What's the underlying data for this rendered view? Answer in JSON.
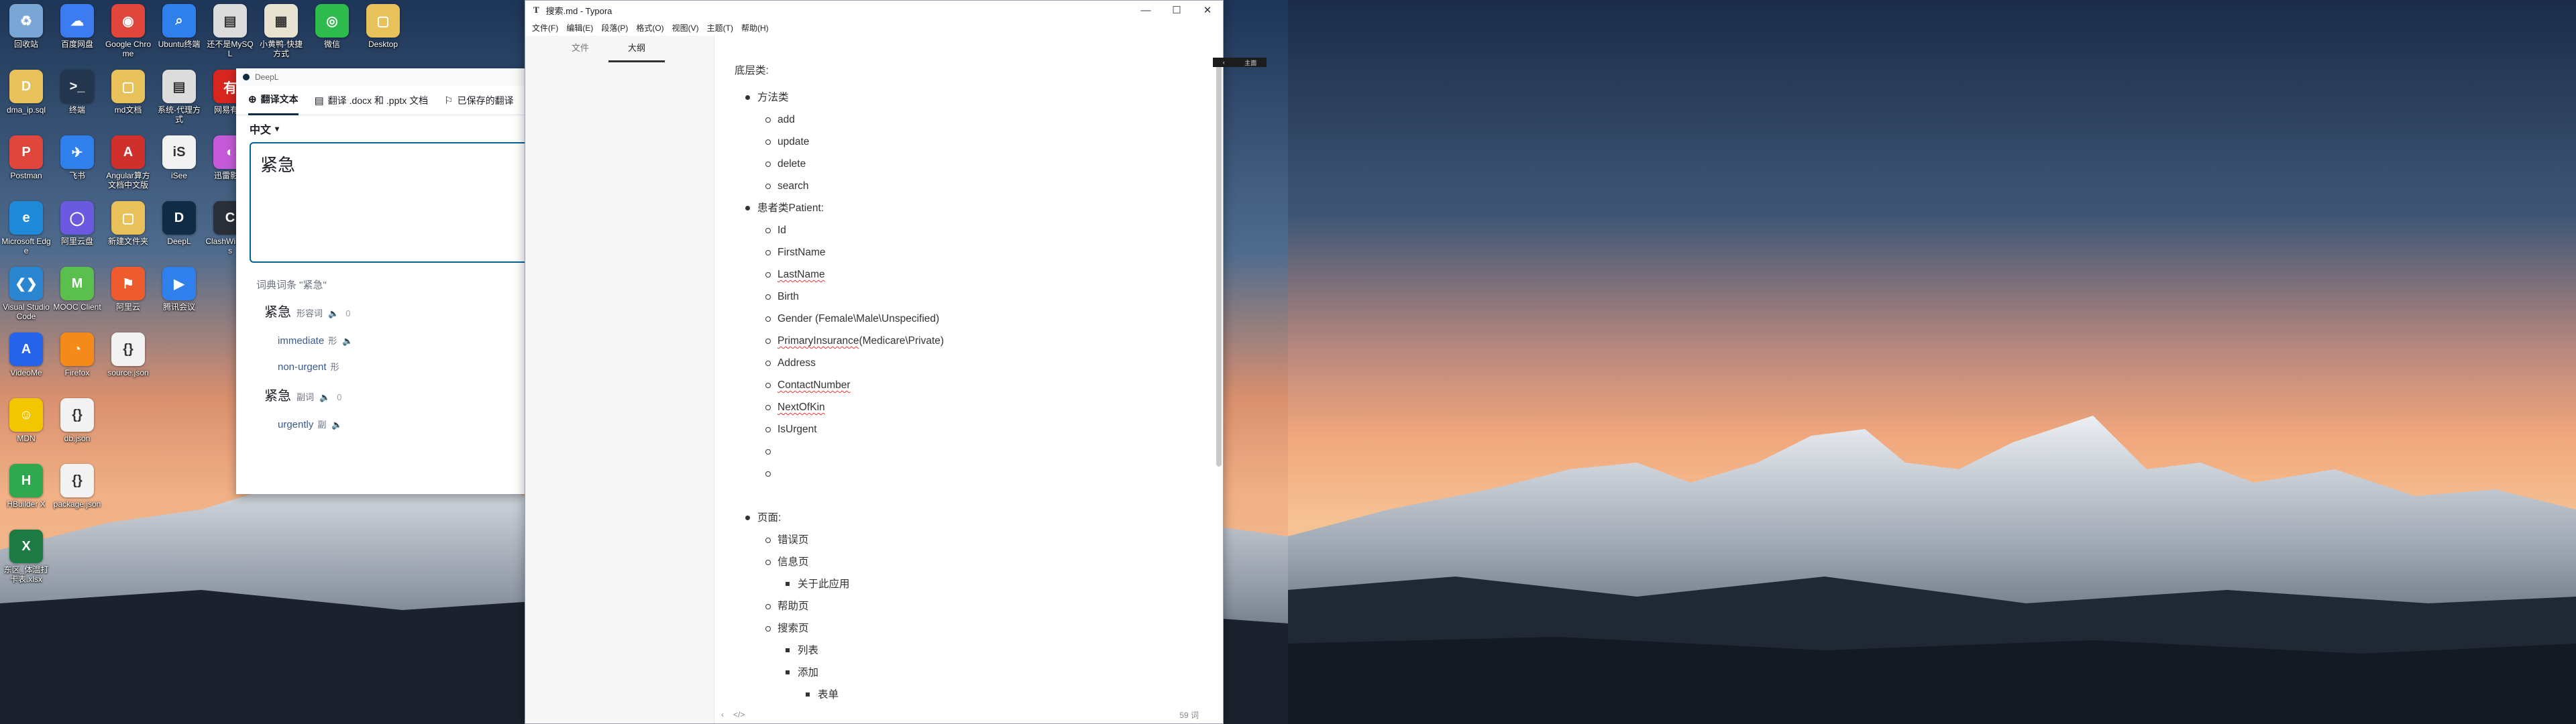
{
  "desktop": {
    "icons": [
      {
        "label": "回收站",
        "glyph": "♻",
        "color": "#7aa6d6"
      },
      {
        "label": "百度网盘",
        "glyph": "☁",
        "color": "#3d7bf0"
      },
      {
        "label": "Google Chrome",
        "glyph": "◉",
        "color": "#e0463b"
      },
      {
        "label": "Ubuntu终端",
        "glyph": "⌕",
        "color": "#2f80ed"
      },
      {
        "label": "还不是MySQL",
        "glyph": "▤",
        "color": "#dcdcdc"
      },
      {
        "label": "小黄鸭·快捷方式",
        "glyph": "▦",
        "color": "#e8e2d0"
      },
      {
        "label": "微信",
        "glyph": "◎",
        "color": "#2dbb4e"
      },
      {
        "label": "Desktop",
        "glyph": "▢",
        "color": "#e8c15a"
      },
      {
        "label": "dma_ip.sql",
        "glyph": "D",
        "color": "#e8c15a"
      },
      {
        "label": "终端",
        "glyph": ">_",
        "color": "#23364d"
      },
      {
        "label": "md文档",
        "glyph": "▢",
        "color": "#e8c15a"
      },
      {
        "label": "系统-代理方式",
        "glyph": "▤",
        "color": "#dcdcdc"
      },
      {
        "label": "网易有道",
        "glyph": "有",
        "color": "#d7261e"
      },
      {
        "label": "Postman",
        "glyph": "P",
        "color": "#e0463b"
      },
      {
        "label": "飞书",
        "glyph": "✈",
        "color": "#2f80ed"
      },
      {
        "label": "Angular算方文档中文版",
        "glyph": "A",
        "color": "#d0302c"
      },
      {
        "label": "iSee",
        "glyph": "iS",
        "color": "#f2f2f2"
      },
      {
        "label": "迅雷影音",
        "glyph": "◐",
        "color": "#c45ad8"
      },
      {
        "label": "Microsoft Edge",
        "glyph": "e",
        "color": "#1f8ad8"
      },
      {
        "label": "阿里云盘",
        "glyph": "◯",
        "color": "#6a5ae0"
      },
      {
        "label": "新建文件夹",
        "glyph": "▢",
        "color": "#e8c15a"
      },
      {
        "label": "DeepL",
        "glyph": "D",
        "color": "#0f2b46"
      },
      {
        "label": "ClashWindows",
        "glyph": "C",
        "color": "#2b2f3a"
      },
      {
        "label": "Visual Studio Code",
        "glyph": "❮❯",
        "color": "#2a86d1"
      },
      {
        "label": "MOOC Client",
        "glyph": "M",
        "color": "#5bbf4e"
      },
      {
        "label": "阿里云",
        "glyph": "⚑",
        "color": "#ee5b2e"
      },
      {
        "label": "腾讯会议",
        "glyph": "▶",
        "color": "#2f80ed"
      },
      {
        "label": "VideoMe",
        "glyph": "A",
        "color": "#2563eb"
      },
      {
        "label": "Firefox",
        "glyph": "◔",
        "color": "#f48a1a"
      },
      {
        "label": "source.json",
        "glyph": "{}",
        "color": "#f2f2f2"
      },
      {
        "label": "MDN",
        "glyph": "☺",
        "color": "#f2c600"
      },
      {
        "label": "db.json",
        "glyph": "{}",
        "color": "#f2f2f2"
      },
      {
        "label": "HBuilder X",
        "glyph": "H",
        "color": "#2fa84f"
      },
      {
        "label": "package.json",
        "glyph": "{}",
        "color": "#f2f2f2"
      },
      {
        "label": "东区_体温打卡表.xlsx",
        "glyph": "X",
        "color": "#1d7a44"
      }
    ]
  },
  "deepl": {
    "window_title": "DeepL",
    "tabs": [
      {
        "label": "翻译文本",
        "icon": "globe-icon"
      },
      {
        "label": "翻译 .docx 和 .pptx 文档",
        "icon": "document-icon"
      },
      {
        "label": "已保存的翻译",
        "icon": "bookmark-icon"
      }
    ],
    "source_lang": "中文",
    "input_text": "紧急",
    "dictionary_header": "词典词条 \"紧急\"",
    "entries": [
      {
        "word": "紧急",
        "pos": "形容词",
        "count": "0",
        "translations": [
          {
            "text": "immediate",
            "pos": "形"
          },
          {
            "text": "non-urgent",
            "pos": "形"
          }
        ]
      },
      {
        "word": "紧急",
        "pos": "副词",
        "count": "0",
        "translations": [
          {
            "text": "urgently",
            "pos": "副"
          }
        ]
      }
    ]
  },
  "typora": {
    "window_title": "搜索.md - Typora",
    "menus": [
      "文件(F)",
      "编辑(E)",
      "段落(P)",
      "格式(O)",
      "视图(V)",
      "主题(T)",
      "帮助(H)"
    ],
    "sidebar_tabs": [
      "文件",
      "大纲"
    ],
    "active_sidebar_tab": "大纲",
    "doc": {
      "heading": "底层类:",
      "section1": {
        "label": "方法类",
        "items": [
          "add",
          "update",
          "delete",
          "search"
        ]
      },
      "section2": {
        "label": "患者类Patient:",
        "items": [
          {
            "text": "Id",
            "spell": false
          },
          {
            "text": "FirstName",
            "spell": false
          },
          {
            "text": "LastName",
            "spell": true
          },
          {
            "text": "Birth",
            "spell": false
          },
          {
            "text": "Gender (Female\\Male\\Unspecified)",
            "spell": false
          },
          {
            "text": "PrimaryInsurance",
            "suffix": "(Medicare\\Private)",
            "spell": true
          },
          {
            "text": "Address",
            "spell": false
          },
          {
            "text": "ContactNumber",
            "spell": true
          },
          {
            "text": "NextOfKin",
            "spell": true
          },
          {
            "text": "IsUrgent",
            "spell": false
          }
        ]
      },
      "section3": {
        "label": "页面:",
        "error_page": "错误页",
        "info_page": "信息页",
        "about_app": "关于此应用",
        "help_page": "帮助页",
        "search_page": "搜索页",
        "list": "列表",
        "add": "添加",
        "form": "表单"
      }
    },
    "status": {
      "back": "‹",
      "source": "</>",
      "word_count": "59 词"
    }
  },
  "tooltip": {
    "text": "主面"
  }
}
